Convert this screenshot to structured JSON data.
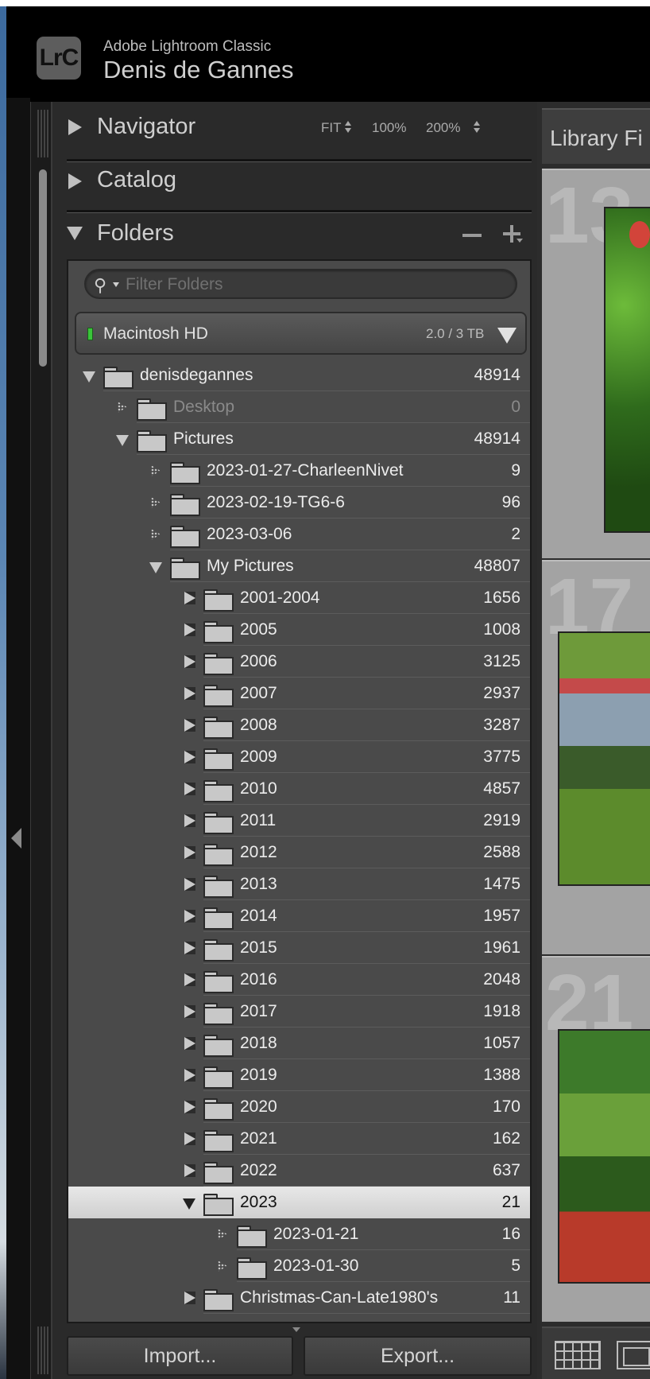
{
  "app": {
    "logo_text": "LrC",
    "app_name": "Adobe Lightroom Classic",
    "user_name": "Denis de Gannes"
  },
  "navigator": {
    "title": "Navigator",
    "zoom_options": [
      "FIT",
      "100%",
      "200%"
    ]
  },
  "catalog": {
    "title": "Catalog"
  },
  "folders": {
    "title": "Folders",
    "filter_placeholder": "Filter Folders",
    "volume": {
      "name": "Macintosh HD",
      "size": "2.0 / 3 TB",
      "status_color": "#3ac43a"
    },
    "tree": [
      {
        "name": "denisdegannes",
        "count": "48914",
        "level": 0,
        "state": "expanded"
      },
      {
        "name": "Desktop",
        "count": "0",
        "level": 1,
        "state": "empty",
        "dim": true
      },
      {
        "name": "Pictures",
        "count": "48914",
        "level": 1,
        "state": "expanded"
      },
      {
        "name": "2023-01-27-CharleenNivet",
        "count": "9",
        "level": 2,
        "state": "empty"
      },
      {
        "name": "2023-02-19-TG6-6",
        "count": "96",
        "level": 2,
        "state": "empty"
      },
      {
        "name": "2023-03-06",
        "count": "2",
        "level": 2,
        "state": "empty"
      },
      {
        "name": "My Pictures",
        "count": "48807",
        "level": 2,
        "state": "expanded"
      },
      {
        "name": "2001-2004",
        "count": "1656",
        "level": 3,
        "state": "collapsed"
      },
      {
        "name": "2005",
        "count": "1008",
        "level": 3,
        "state": "collapsed"
      },
      {
        "name": "2006",
        "count": "3125",
        "level": 3,
        "state": "collapsed"
      },
      {
        "name": "2007",
        "count": "2937",
        "level": 3,
        "state": "collapsed"
      },
      {
        "name": "2008",
        "count": "3287",
        "level": 3,
        "state": "collapsed"
      },
      {
        "name": "2009",
        "count": "3775",
        "level": 3,
        "state": "collapsed"
      },
      {
        "name": "2010",
        "count": "4857",
        "level": 3,
        "state": "collapsed"
      },
      {
        "name": "2011",
        "count": "2919",
        "level": 3,
        "state": "collapsed"
      },
      {
        "name": "2012",
        "count": "2588",
        "level": 3,
        "state": "collapsed"
      },
      {
        "name": "2013",
        "count": "1475",
        "level": 3,
        "state": "collapsed"
      },
      {
        "name": "2014",
        "count": "1957",
        "level": 3,
        "state": "collapsed"
      },
      {
        "name": "2015",
        "count": "1961",
        "level": 3,
        "state": "collapsed"
      },
      {
        "name": "2016",
        "count": "2048",
        "level": 3,
        "state": "collapsed"
      },
      {
        "name": "2017",
        "count": "1918",
        "level": 3,
        "state": "collapsed"
      },
      {
        "name": "2018",
        "count": "1057",
        "level": 3,
        "state": "collapsed"
      },
      {
        "name": "2019",
        "count": "1388",
        "level": 3,
        "state": "collapsed"
      },
      {
        "name": "2020",
        "count": "170",
        "level": 3,
        "state": "collapsed"
      },
      {
        "name": "2021",
        "count": "162",
        "level": 3,
        "state": "collapsed"
      },
      {
        "name": "2022",
        "count": "637",
        "level": 3,
        "state": "collapsed"
      },
      {
        "name": "2023",
        "count": "21",
        "level": 3,
        "state": "expanded",
        "selected": true
      },
      {
        "name": "2023-01-21",
        "count": "16",
        "level": 4,
        "state": "empty"
      },
      {
        "name": "2023-01-30",
        "count": "5",
        "level": 4,
        "state": "empty"
      },
      {
        "name": "Christmas-Can-Late1980's",
        "count": "11",
        "level": 3,
        "state": "collapsed"
      }
    ]
  },
  "buttons": {
    "import_label": "Import...",
    "export_label": "Export..."
  },
  "library": {
    "filter_bar_label": "Library Fi",
    "cell_numbers": [
      "13",
      "17",
      "21"
    ]
  }
}
